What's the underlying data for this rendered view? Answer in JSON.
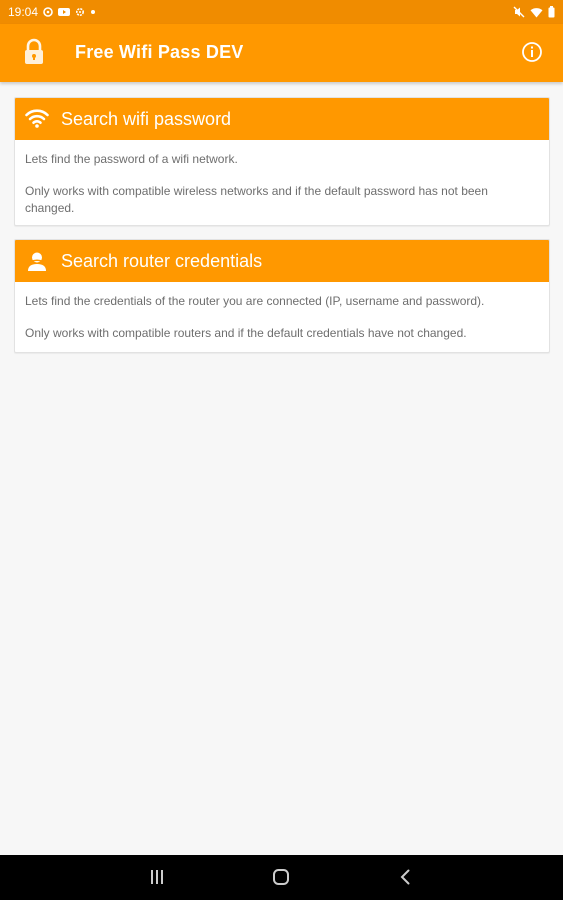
{
  "status_bar": {
    "time": "19:04",
    "left_icons": [
      "sync-icon",
      "youtube-icon",
      "settings-icon",
      "dot-icon"
    ],
    "right_icons": [
      "mute-icon",
      "wifi-icon",
      "battery-icon"
    ]
  },
  "app_bar": {
    "title": "Free Wifi Pass DEV",
    "left_icon": "lock-icon",
    "right_icon": "info-icon"
  },
  "cards": [
    {
      "icon": "wifi-icon",
      "title": "Search wifi password",
      "line1": "Lets find the password of a wifi network.",
      "line2": "Only works with compatible wireless networks and if the default password has not been changed."
    },
    {
      "icon": "user-icon",
      "title": "Search router credentials",
      "line1": "Lets find the credentials of the router you are connected (IP, username and password).",
      "line2": "Only works with compatible routers and if the default credentials have not changed."
    }
  ],
  "nav_bar": {
    "buttons": [
      "recents-icon",
      "home-icon",
      "back-icon"
    ]
  },
  "colors": {
    "primary": "#ff9800",
    "status_bar": "#f08c00",
    "background": "#f7f7f7",
    "body_text": "#6e6e6e"
  }
}
